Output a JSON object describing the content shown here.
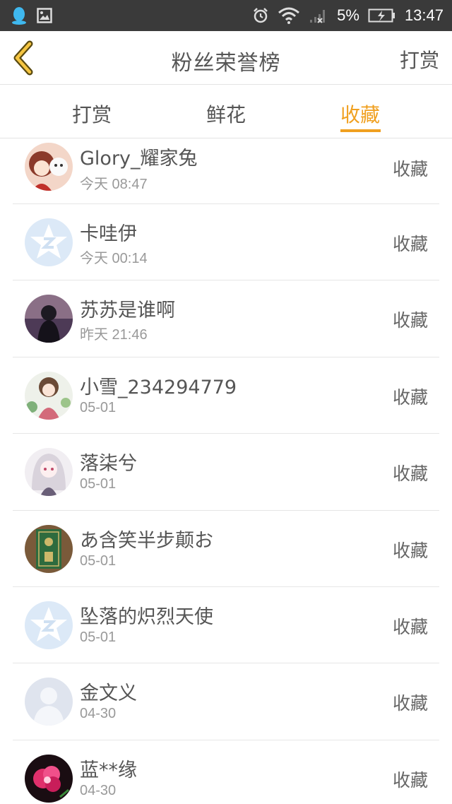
{
  "status_bar": {
    "battery": "5%",
    "time": "13:47"
  },
  "header": {
    "title": "粉丝荣誉榜",
    "action": "打赏"
  },
  "tabs": [
    {
      "label": "打赏",
      "active": false
    },
    {
      "label": "鲜花",
      "active": false
    },
    {
      "label": "收藏",
      "active": true
    }
  ],
  "colors": {
    "accent": "#f0a020",
    "status_bar": "#3a3a3a"
  },
  "fans": [
    {
      "name": "Glory_耀家兔",
      "time": "今天 08:47",
      "action": "收藏",
      "avatar": "anime-girl-with-dog"
    },
    {
      "name": "卡哇伊",
      "time": "今天 00:14",
      "action": "收藏",
      "avatar": "default-qq-star"
    },
    {
      "name": "苏苏是谁啊",
      "time": "昨天 21:46",
      "action": "收藏",
      "avatar": "dark-portrait"
    },
    {
      "name": "小雪_234294779",
      "time": "05-01",
      "action": "收藏",
      "avatar": "anime-girl-kimono"
    },
    {
      "name": "落柒兮",
      "time": "05-01",
      "action": "收藏",
      "avatar": "anime-girl-praying"
    },
    {
      "name": "あ含笑半步颠お",
      "time": "05-01",
      "action": "收藏",
      "avatar": "green-book-cover"
    },
    {
      "name": "坠落的炽烈天使",
      "time": "05-01",
      "action": "收藏",
      "avatar": "default-qq-star"
    },
    {
      "name": "金文义",
      "time": "04-30",
      "action": "收藏",
      "avatar": "default-person"
    },
    {
      "name": "蓝**缘",
      "time": "04-30",
      "action": "收藏",
      "avatar": "pink-flower"
    }
  ]
}
